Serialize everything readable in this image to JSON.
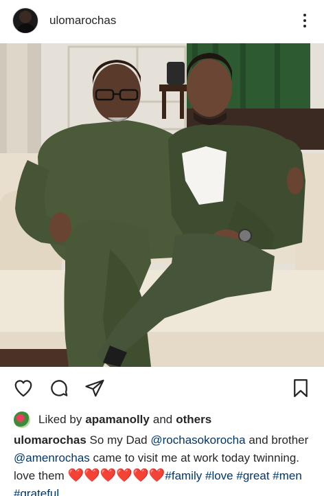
{
  "post": {
    "username": "ulomarochas"
  },
  "icons": {
    "more": "more-options-icon",
    "like": "heart-outline-icon",
    "comment": "comment-icon",
    "share": "paper-plane-icon",
    "save": "bookmark-icon"
  },
  "likes": {
    "prefix": "Liked by",
    "user": "apamanolly",
    "and": "and",
    "others": "others"
  },
  "caption": {
    "username": "ulomarochas",
    "text1": "So my Dad",
    "mention1": "@rochasokorocha",
    "text2": "and brother",
    "mention2": "@amenrochas",
    "text3": "came to visit me at work today twinning. love them",
    "hearts": "❤️❤️❤️❤️❤️❤️",
    "hashtags": [
      "#family",
      "#love",
      "#great",
      "#men",
      "#grateful"
    ]
  },
  "colors": {
    "link": "#00376b",
    "text": "#262626",
    "tracksuit": "#4a5a3a"
  }
}
